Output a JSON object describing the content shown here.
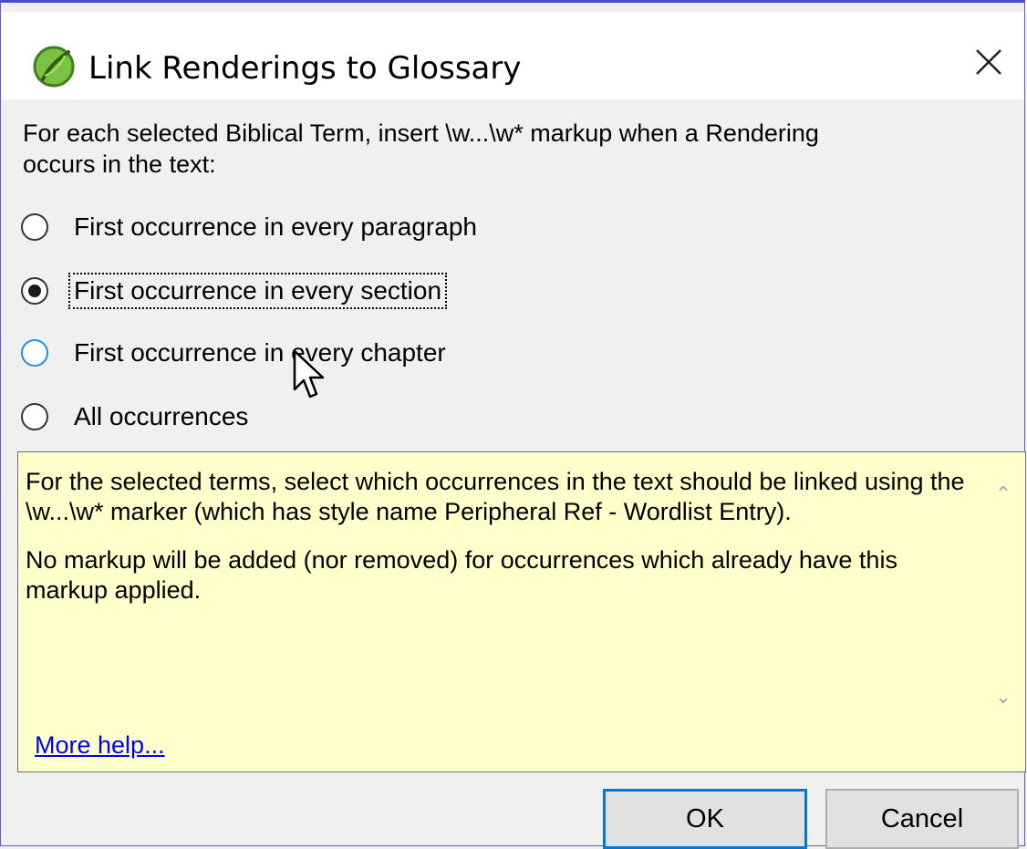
{
  "window": {
    "title": "Link Renderings to Glossary",
    "icon": "paratext-leaf-icon"
  },
  "instruction": {
    "line1": "For each selected Biblical Term, insert \\w...\\w* markup when a Rendering",
    "line2": "occurs in the text:"
  },
  "options": [
    {
      "label": "First occurrence in every paragraph",
      "checked": false
    },
    {
      "label": "First occurrence in every section",
      "checked": true
    },
    {
      "label": "First occurrence in every chapter",
      "checked": false
    },
    {
      "label": "All occurrences",
      "checked": false
    }
  ],
  "help": {
    "paragraph1": "For the selected terms, select which occurrences in the text should be linked using the \\w...\\w* marker (which has style name Peripheral Ref - Wordlist Entry).",
    "paragraph2": "No markup will be added (nor removed) for occurrences which already have this markup applied.",
    "more_help_link": "More help..."
  },
  "buttons": {
    "ok": "OK",
    "cancel": "Cancel"
  },
  "colors": {
    "help_background": "#ffffcc",
    "link": "#0000ee",
    "focus_border": "#0078d7",
    "icon_green": "#6bb82c"
  }
}
